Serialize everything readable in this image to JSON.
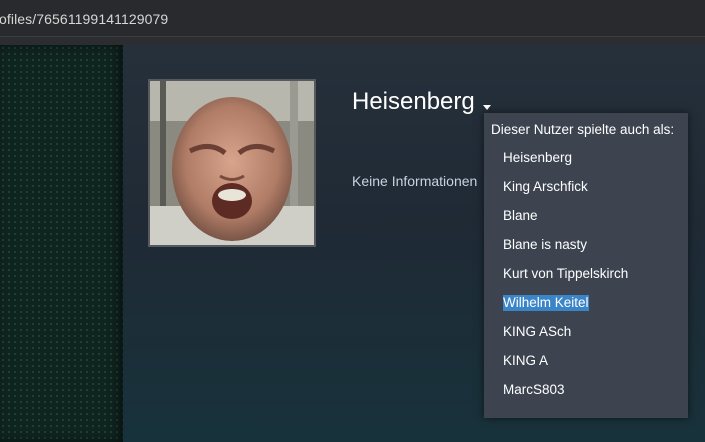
{
  "browser": {
    "url": "ofiles/76561199141129079"
  },
  "profile": {
    "persona_name": "Heisenberg",
    "summary": "Keine Informationen"
  },
  "aliases_popup": {
    "header": "Dieser Nutzer spielte auch als:",
    "items": [
      "Heisenberg",
      "King Arschfick",
      "Blane",
      "Blane is nasty",
      "Kurt von Tippelskirch",
      "Wilhelm Keitel",
      "KING ASch",
      "KING A",
      "MarcS803"
    ],
    "selected_item": "Wilhelm Keitel"
  }
}
